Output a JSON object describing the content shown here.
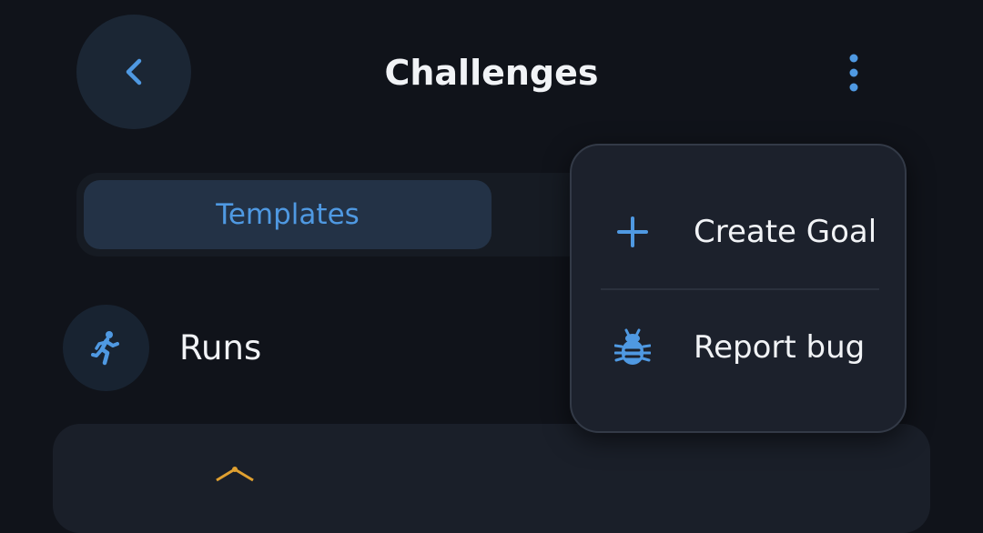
{
  "header": {
    "title": "Challenges"
  },
  "segmented": {
    "active_tab": "Templates"
  },
  "category": {
    "label": "Runs",
    "icon": "running-icon"
  },
  "menu": {
    "items": [
      {
        "label": "Create Goal",
        "icon": "plus-icon"
      },
      {
        "label": "Report bug",
        "icon": "bug-icon"
      }
    ]
  },
  "colors": {
    "background": "#10131a",
    "accent": "#4f99e2",
    "surface": "#1c212c",
    "tab_active": "#233246",
    "text": "#f1f3f6",
    "card_mark": "#e0a030"
  }
}
